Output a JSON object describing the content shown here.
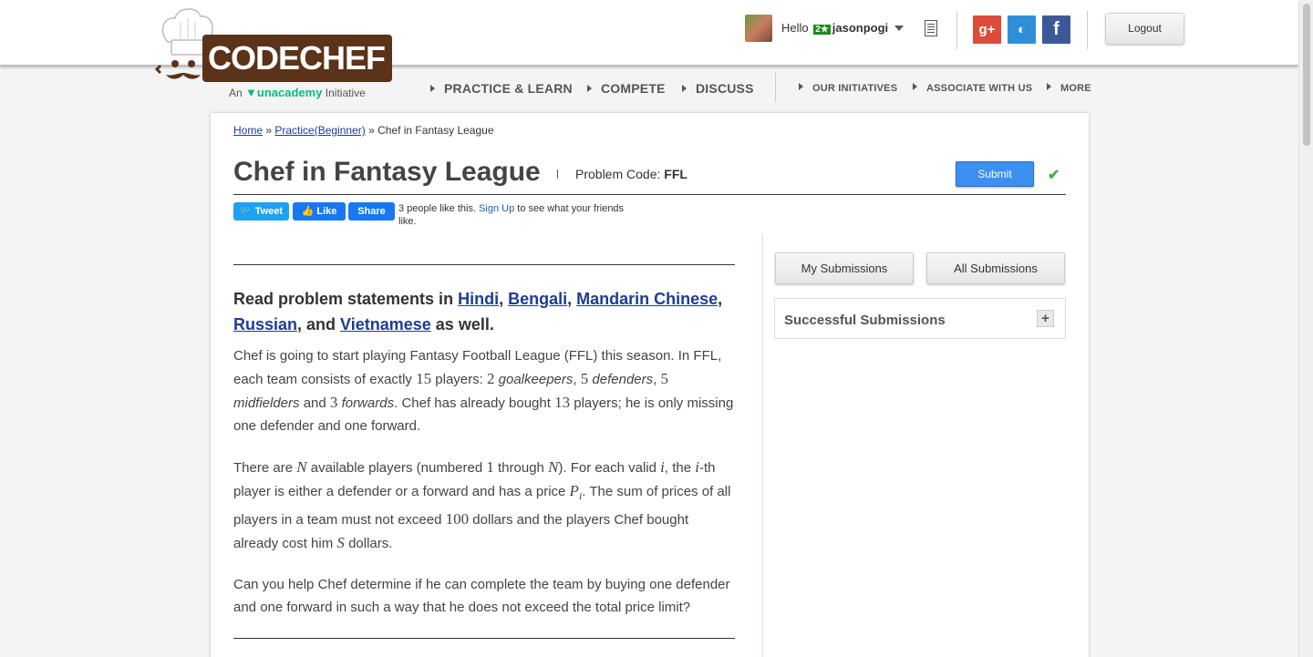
{
  "header": {
    "brand": "CODECHEF",
    "tagline_prefix": "An",
    "tagline_brand": "unacademy",
    "tagline_suffix": "Initiative",
    "hello": "Hello",
    "rating_badge": "2★",
    "username": "jasonpogi",
    "social": {
      "google": "g+",
      "github": "◐",
      "facebook": "f"
    },
    "logout": "Logout"
  },
  "nav": {
    "items": [
      "PRACTICE & LEARN",
      "COMPETE",
      "DISCUSS"
    ],
    "secondary": [
      "OUR INITIATIVES",
      "ASSOCIATE WITH US",
      "MORE"
    ]
  },
  "breadcrumb": {
    "home": "Home",
    "sep1": " » ",
    "practice": "Practice(Beginner)",
    "sep2": " » ",
    "current": "Chef in Fantasy League"
  },
  "problem": {
    "title": "Chef in Fantasy League",
    "code_label": "Problem Code:",
    "code": "FFL",
    "submit": "Submit"
  },
  "share": {
    "tweet": "Tweet",
    "like": "Like",
    "share": "Share",
    "likes_text": "3 people like this.",
    "signup": "Sign Up",
    "likes_suffix": "to see what your friends like."
  },
  "statement": {
    "read_prefix": "Read problem statements in",
    "languages": [
      "Hindi",
      "Bengali",
      "Mandarin Chinese",
      "Russian",
      "Vietnamese"
    ],
    "read_suffix": "as well.",
    "p1": {
      "a": "Chef is going to start playing Fantasy Football League (FFL) this season. In FFL, each team consists of exactly",
      "n15": "15",
      "b": "players:",
      "n2": "2",
      "gk": "goalkeepers",
      "n5a": "5",
      "def": "defenders",
      "n5b": "5",
      "mid": "midfielders",
      "and": "and",
      "n3": "3",
      "fwd": "forwards",
      "c": ". Chef has already bought",
      "n13": "13",
      "d": "players; he is only missing one defender and one forward."
    },
    "p2": {
      "a": "There are",
      "N": "N",
      "b": "available players (numbered",
      "one": "1",
      "c": "through",
      "N2": "N",
      "d": "). For each valid",
      "i": "i",
      "e": ", the",
      "i2": "i",
      "f": "-th player is either a defender or a forward and has a price",
      "P": "P",
      "sub": "i",
      "g": ". The sum of prices of all players in a team must not exceed",
      "hundred": "100",
      "h": "dollars and the players Chef bought already cost him",
      "S": "S",
      "k": "dollars."
    },
    "p3": "Can you help Chef determine if he can complete the team by buying one defender and one forward in such a way that he does not exceed the total price limit?"
  },
  "sidebar": {
    "my_submissions": "My Submissions",
    "all_submissions": "All Submissions",
    "successful": "Successful Submissions",
    "expand": "+"
  }
}
